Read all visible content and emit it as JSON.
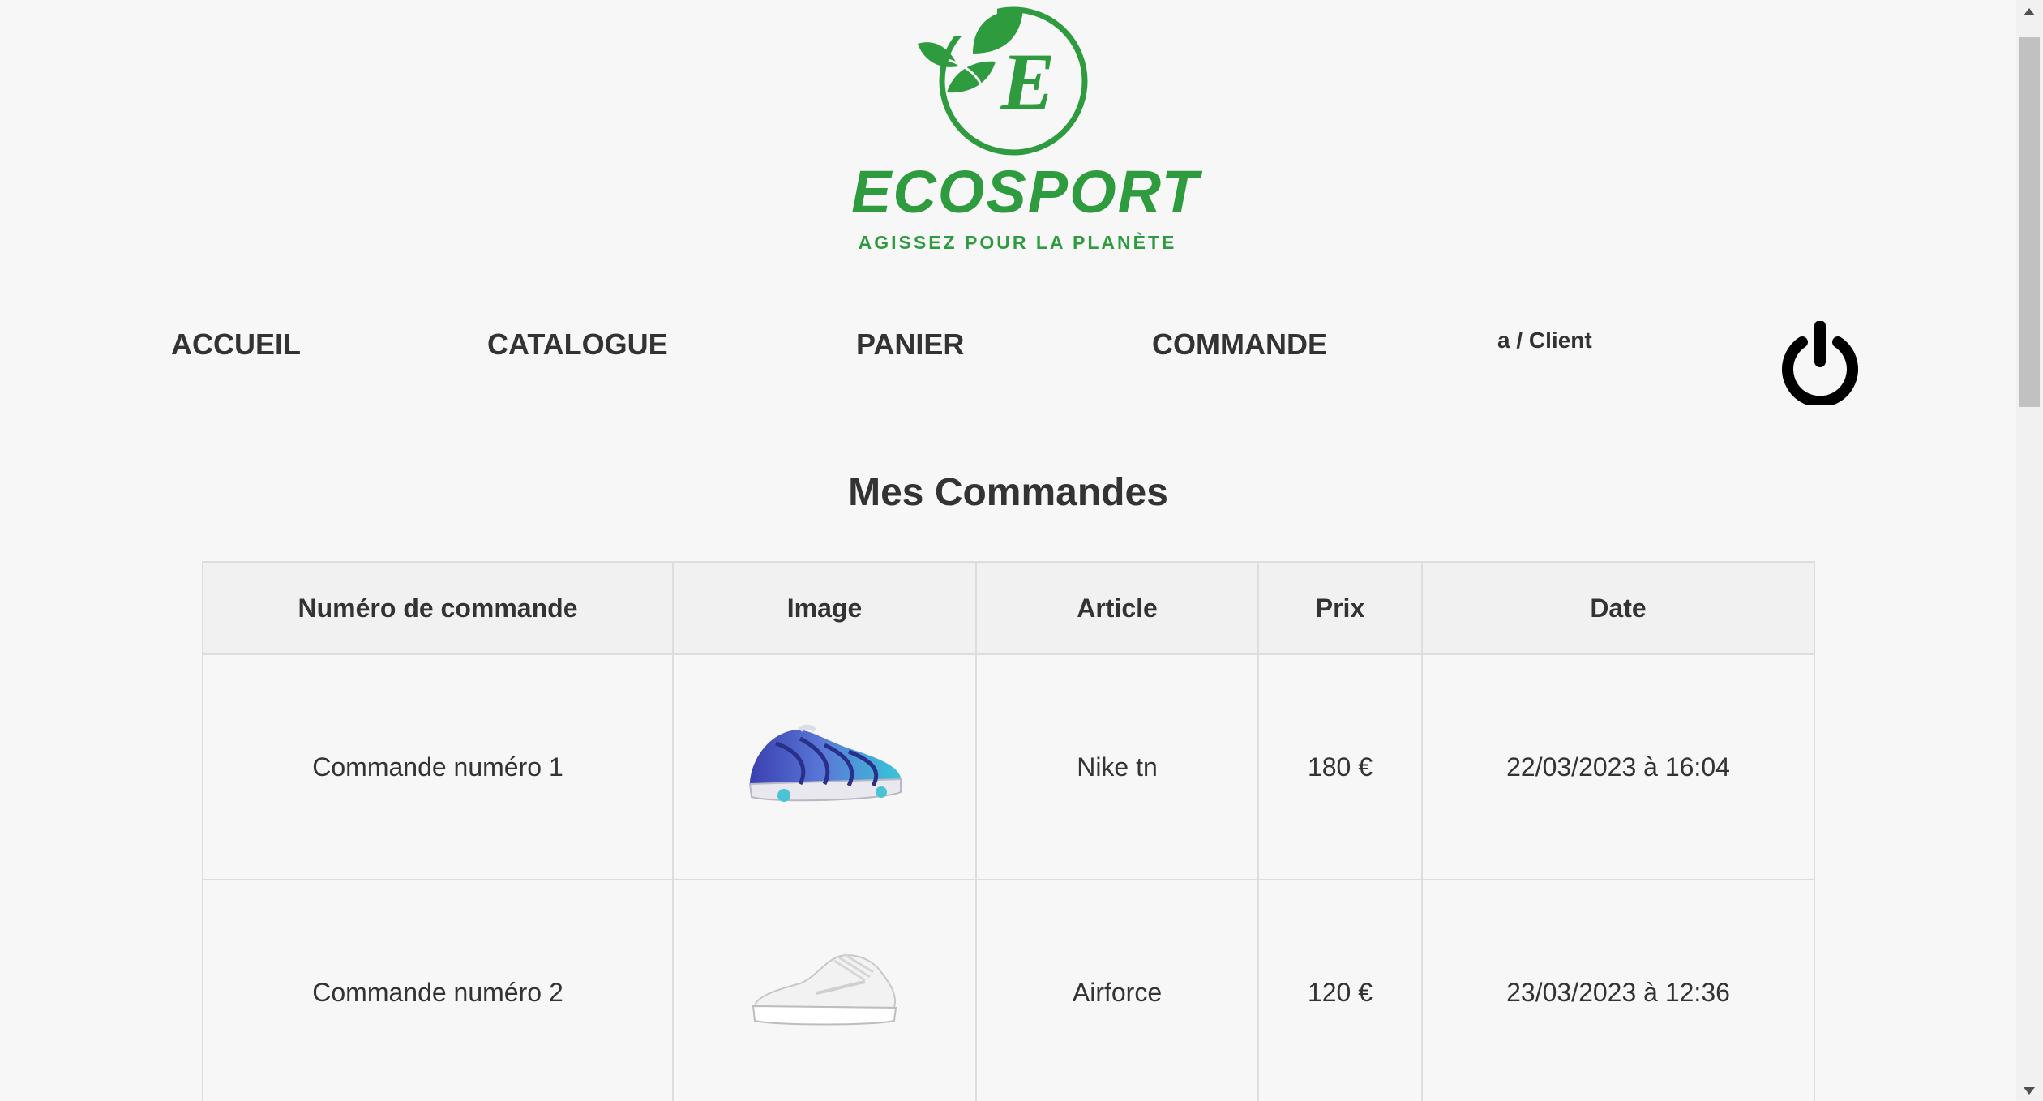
{
  "brand": {
    "logo_letter": "E",
    "name": "ECOSPORT",
    "tagline": "AGISSEZ POUR LA PLANÈTE",
    "color": "#2e9b3f"
  },
  "nav": {
    "items": [
      {
        "label": "ACCUEIL"
      },
      {
        "label": "CATALOGUE"
      },
      {
        "label": "PANIER"
      },
      {
        "label": "COMMANDE"
      }
    ],
    "user": "a / Client",
    "logout_icon": "power-icon"
  },
  "page_title": "Mes Commandes",
  "orders": {
    "headers": [
      "Numéro de commande",
      "Image",
      "Article",
      "Prix",
      "Date"
    ],
    "rows": [
      {
        "number": "Commande numéro 1",
        "image": "nike-tn-shoe",
        "article": "Nike tn",
        "price": "180 €",
        "date": "22/03/2023 à 16:04"
      },
      {
        "number": "Commande numéro 2",
        "image": "airforce-shoe",
        "article": "Airforce",
        "price": "120 €",
        "date": "23/03/2023 à 12:36"
      }
    ]
  }
}
